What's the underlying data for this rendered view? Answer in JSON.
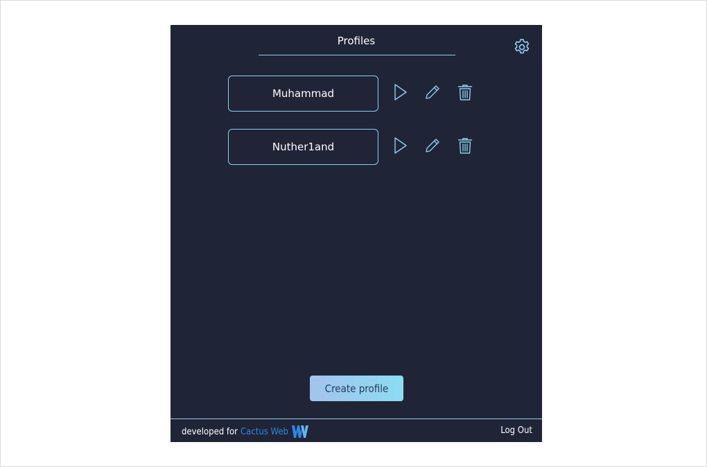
{
  "header": {
    "title": "Profiles",
    "settings_icon": "gear-icon"
  },
  "profiles": [
    {
      "name": "Muhammad"
    },
    {
      "name": "Nuther1and"
    }
  ],
  "row_actions": {
    "play_icon": "play-icon",
    "edit_icon": "pencil-icon",
    "delete_icon": "trash-icon"
  },
  "create_button": {
    "label": "Create profile"
  },
  "footer": {
    "developed_for": "developed for",
    "brand_name": "Cactus Web",
    "brand_logo": "cactus-web-logo",
    "logout_label": "Log Out"
  },
  "colors": {
    "panel_background": "#1f2436",
    "accent": "#8fd0ec",
    "brand_link": "#2f86e6",
    "button_gradient_start": "#a2c4ee",
    "button_gradient_end": "#8cdcf2"
  }
}
